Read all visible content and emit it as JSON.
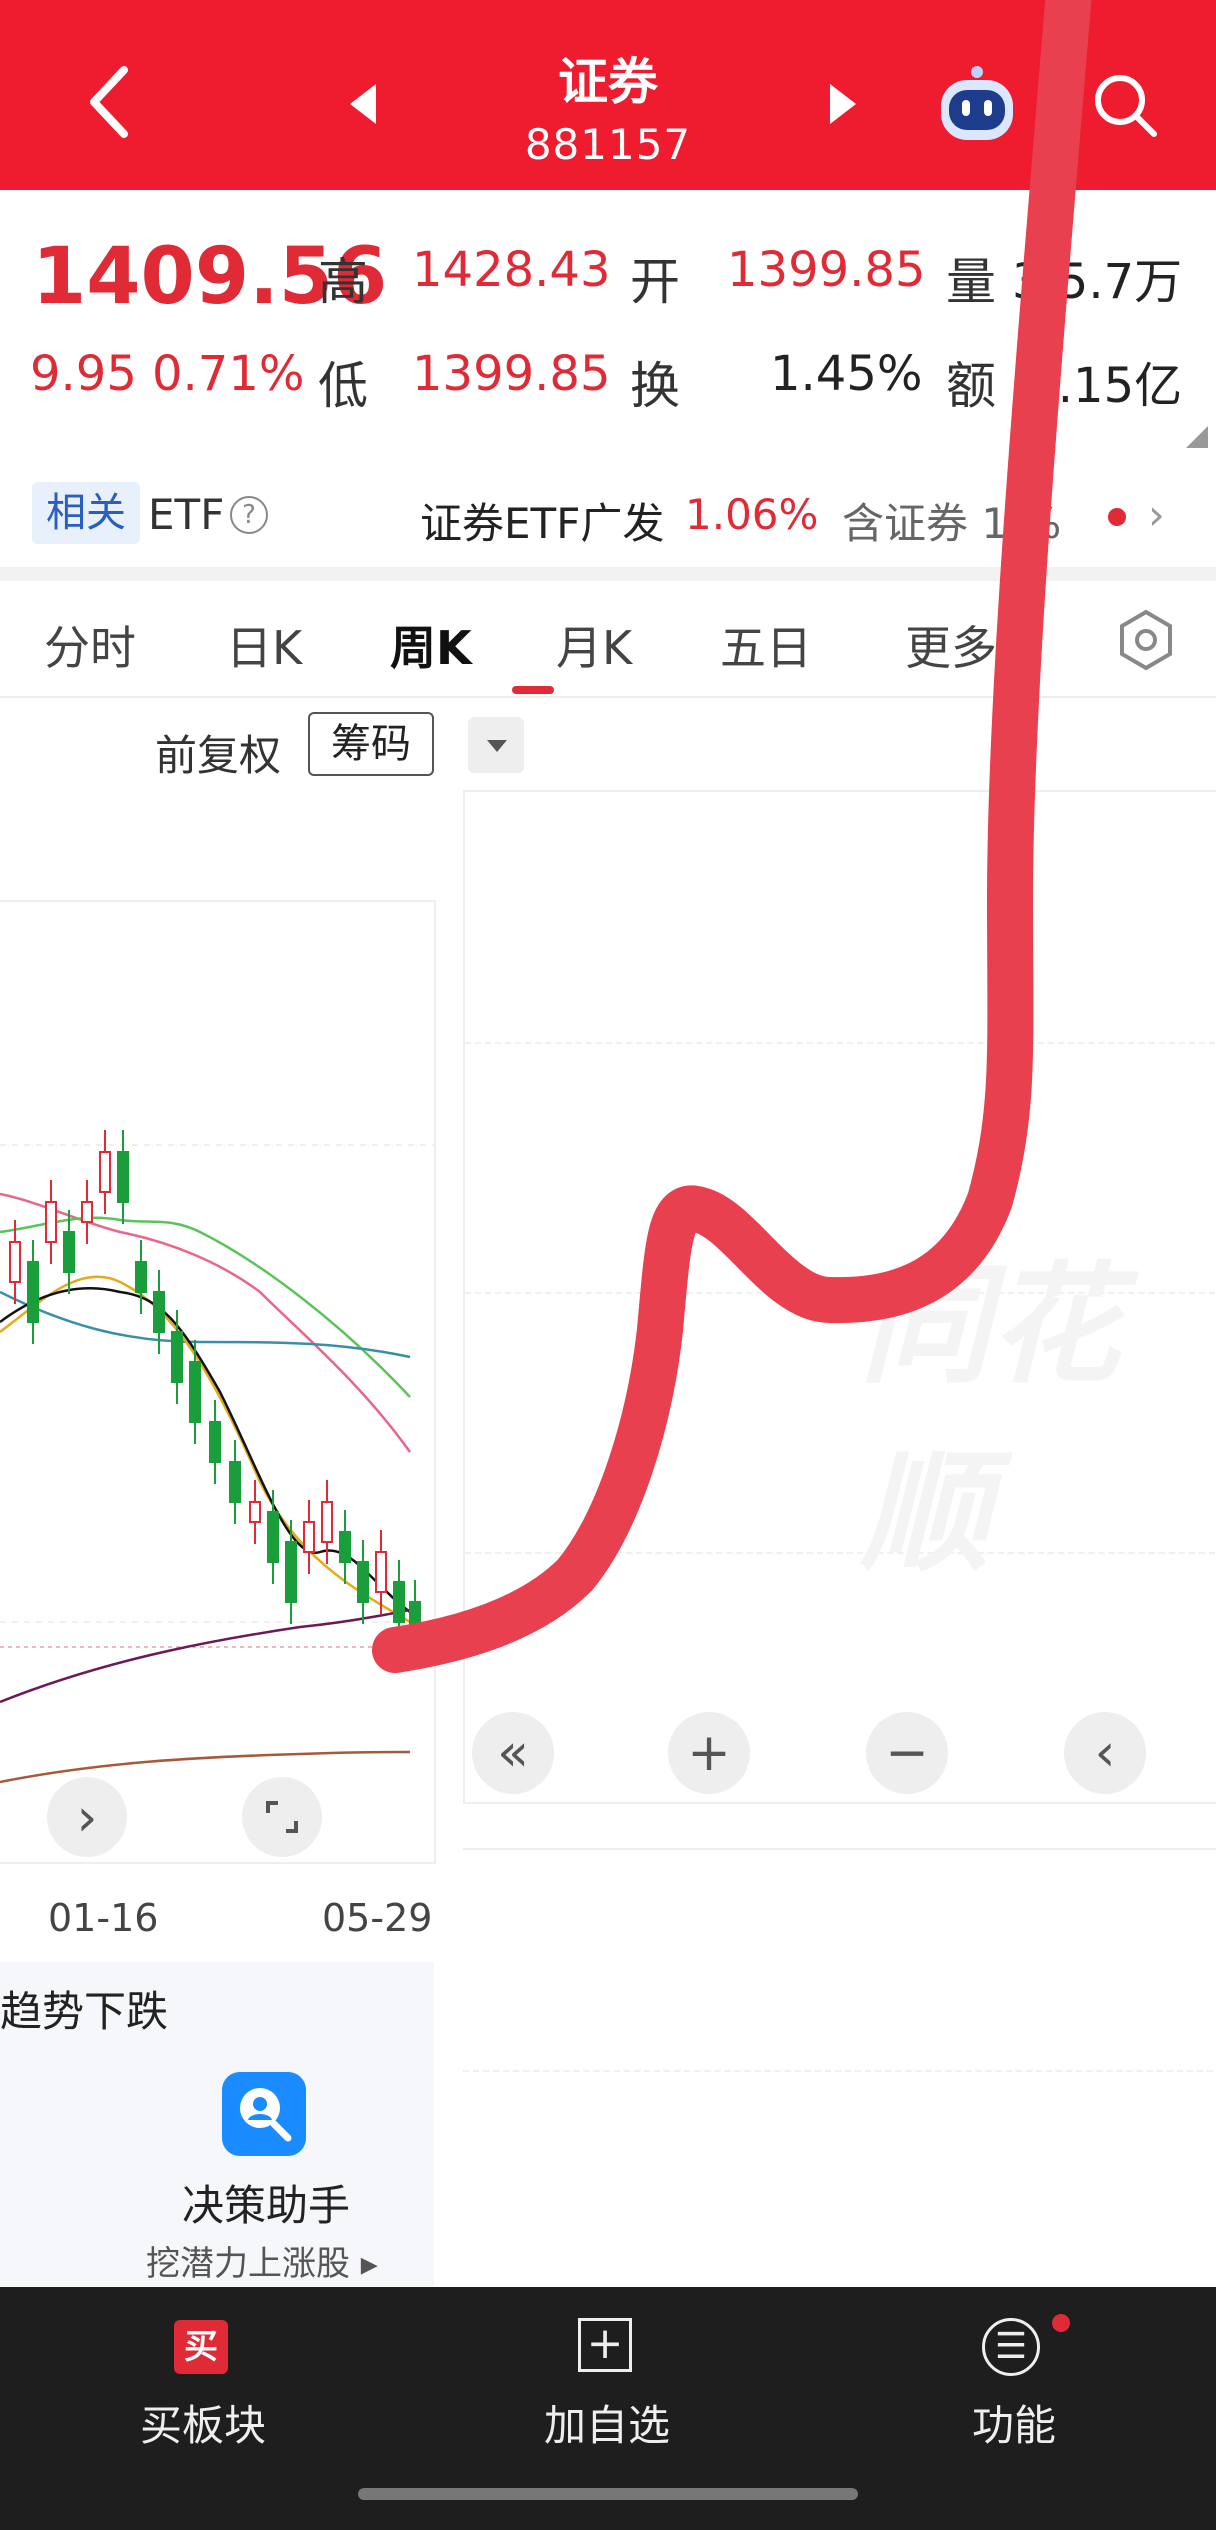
{
  "header": {
    "title": "证券",
    "code": "881157"
  },
  "quote": {
    "price": "1409.56",
    "change": "9.95",
    "change_pct": "0.71%",
    "high_label": "高",
    "high": "1428.43",
    "open_label": "开",
    "open": "1399.85",
    "volume_label": "量",
    "volume": "3  5.7万",
    "low_label": "低",
    "low": "1399.85",
    "turnover_label": "换",
    "turnover": "1.45%",
    "amount_label": "额",
    "amount": "4  .15亿"
  },
  "etf": {
    "badge": "相关",
    "label": "ETF",
    "help": "?",
    "name": "证券ETF广发",
    "pct": "1.06%",
    "holding": "含证券 1    %",
    "chevron": "›"
  },
  "tabs": [
    "分时",
    "日K",
    "周K",
    "月K",
    "五日",
    "更多"
  ],
  "chart": {
    "adj_label": "前复权",
    "chips_label": "筹码",
    "watermark": "同花顺",
    "dates": [
      "01-16",
      "05-29"
    ],
    "buttons": {
      "rewind": "«",
      "zoom_in": "+",
      "zoom_out": "−",
      "back": "‹",
      "next": "›"
    }
  },
  "card": {
    "trend": "趋势下跌",
    "title": "决策助手",
    "sub": "挖潜力上涨股 ▸"
  },
  "bottom": {
    "buy_icon": "买",
    "buy": "买板块",
    "add_icon": "+",
    "add": "加自选",
    "fn_icon": "☰",
    "fn": "功能"
  },
  "colors": {
    "brand": "#ee1c2e",
    "up": "#e02a36",
    "down": "#1a9e3b"
  }
}
